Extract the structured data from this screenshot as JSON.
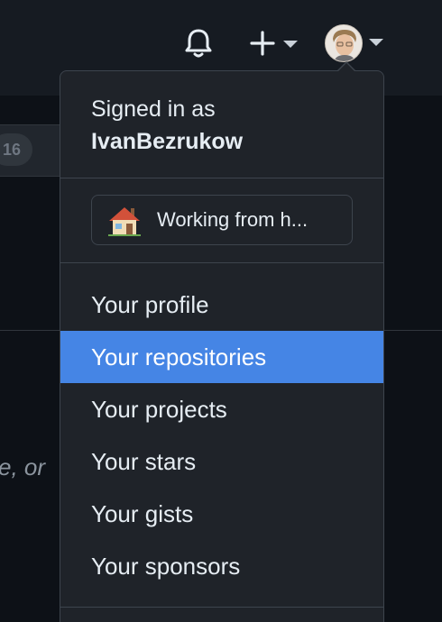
{
  "header": {
    "notifications_icon": "bell-icon",
    "create_icon": "plus-icon",
    "avatar_icon": "avatar",
    "caret_color": "#c9d1d9"
  },
  "background": {
    "counter": "16",
    "italic_fragment": "e, or"
  },
  "dropdown": {
    "signed_in_label": "Signed in as",
    "username": "IvanBezrukow",
    "status": {
      "emoji_icon": "house-icon",
      "text": "Working from h..."
    },
    "menu_items": [
      {
        "label": "Your profile",
        "active": false
      },
      {
        "label": "Your repositories",
        "active": true
      },
      {
        "label": "Your projects",
        "active": false
      },
      {
        "label": "Your stars",
        "active": false
      },
      {
        "label": "Your gists",
        "active": false
      },
      {
        "label": "Your sponsors",
        "active": false
      }
    ]
  },
  "colors": {
    "header_bg": "#161b22",
    "dropdown_bg": "#1f2329",
    "highlight": "#4585e5",
    "text": "#e6edf3"
  }
}
